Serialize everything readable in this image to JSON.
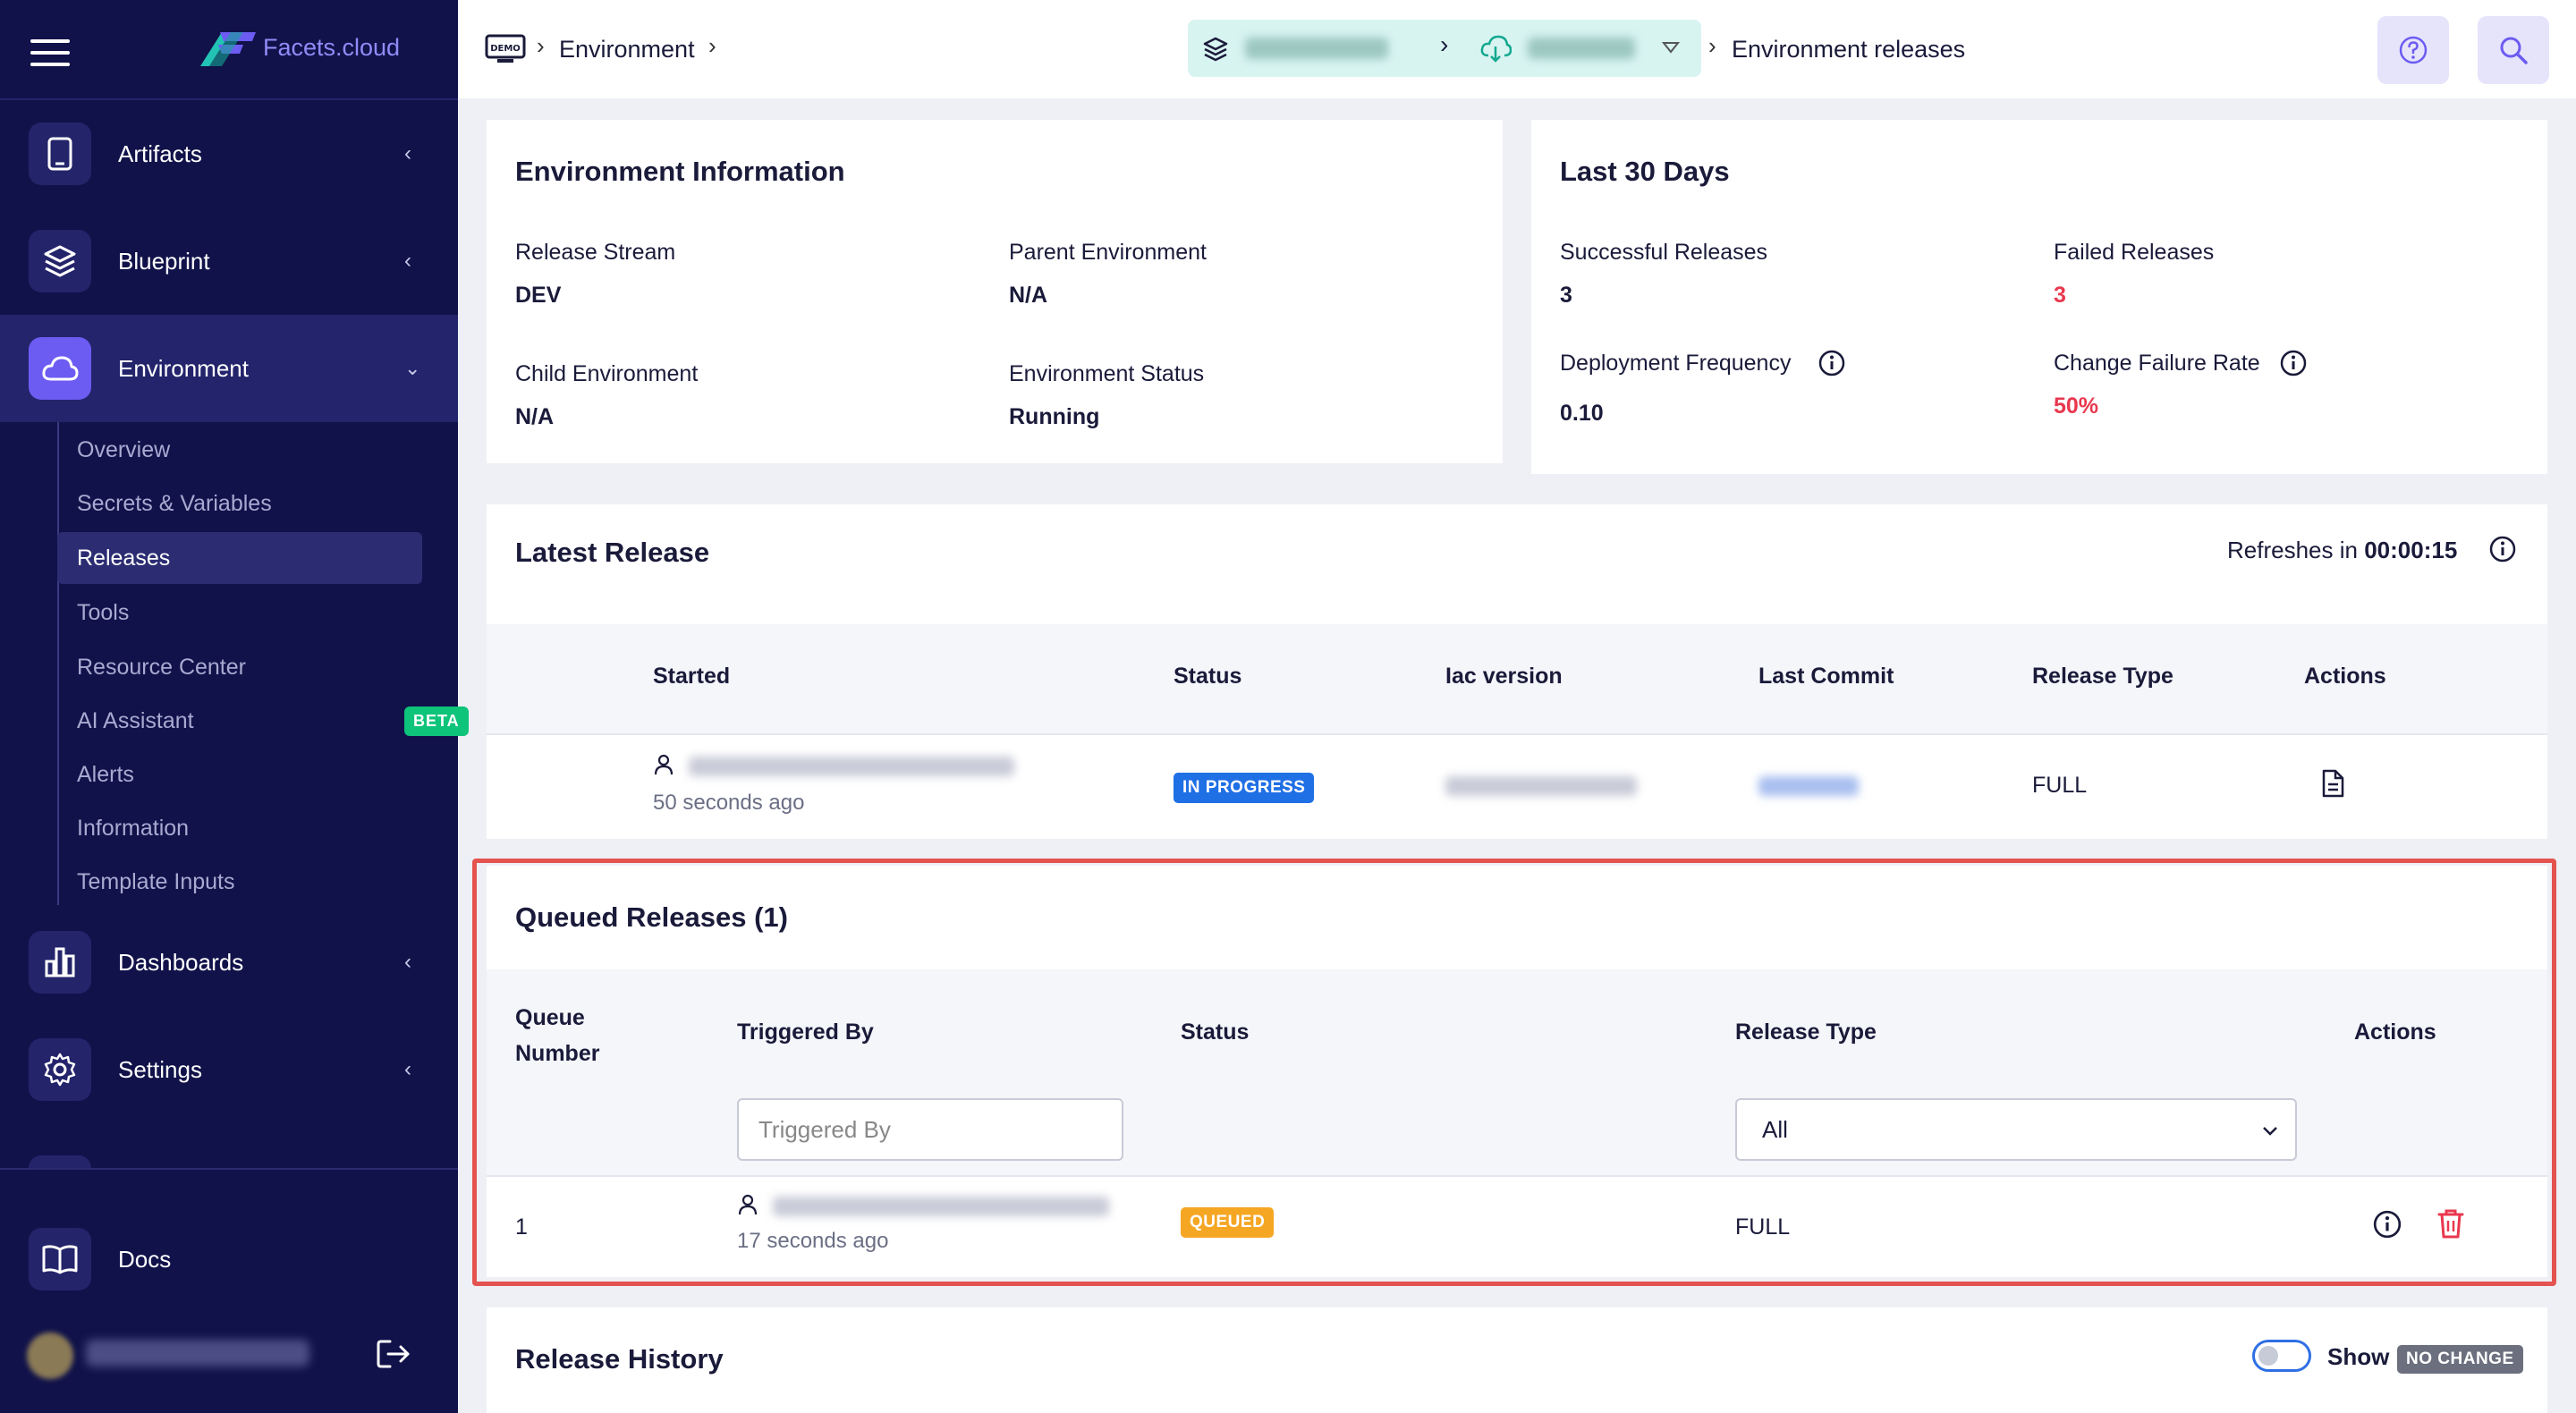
{
  "app": {
    "logo_text": "Facets.cloud"
  },
  "sidebar": {
    "items": [
      {
        "label": "Artifacts",
        "icon": "tablet-icon"
      },
      {
        "label": "Blueprint",
        "icon": "layers-icon"
      },
      {
        "label": "Environment",
        "icon": "cloud-icon"
      },
      {
        "label": "Dashboards",
        "icon": "bar-chart-icon"
      },
      {
        "label": "Settings",
        "icon": "gear-icon"
      }
    ],
    "env_sub": [
      {
        "label": "Overview"
      },
      {
        "label": "Secrets & Variables"
      },
      {
        "label": "Releases"
      },
      {
        "label": "Tools"
      },
      {
        "label": "Resource Center"
      },
      {
        "label": "AI Assistant",
        "badge": "BETA"
      },
      {
        "label": "Alerts"
      },
      {
        "label": "Information"
      },
      {
        "label": "Template Inputs"
      }
    ],
    "docs_label": "Docs"
  },
  "breadcrumb": {
    "demo_label": "DEMO",
    "environment": "Environment",
    "current": "Environment releases"
  },
  "env_info": {
    "title": "Environment Information",
    "release_stream_label": "Release Stream",
    "release_stream_value": "DEV",
    "parent_env_label": "Parent Environment",
    "parent_env_value": "N/A",
    "child_env_label": "Child Environment",
    "child_env_value": "N/A",
    "env_status_label": "Environment Status",
    "env_status_value": "Running"
  },
  "last30": {
    "title": "Last 30 Days",
    "successful_label": "Successful Releases",
    "successful_value": "3",
    "failed_label": "Failed Releases",
    "failed_value": "3",
    "freq_label": "Deployment Frequency",
    "freq_value": "0.10",
    "cfr_label": "Change Failure Rate",
    "cfr_value": "50%"
  },
  "latest": {
    "title": "Latest Release",
    "refresh_prefix": "Refreshes in",
    "refresh_time": "00:00:15",
    "columns": [
      "Started",
      "Status",
      "Iac version",
      "Last Commit",
      "Release Type",
      "Actions"
    ],
    "row": {
      "started_ago": "50 seconds ago",
      "status": "IN PROGRESS",
      "release_type": "FULL"
    }
  },
  "queued": {
    "title": "Queued Releases (1)",
    "col_queue_line1": "Queue",
    "col_queue_line2": "Number",
    "col_triggered": "Triggered By",
    "col_status": "Status",
    "col_release_type": "Release Type",
    "col_actions": "Actions",
    "filter_triggered_placeholder": "Triggered By",
    "filter_release_type_value": "All",
    "row": {
      "queue_number": "1",
      "triggered_ago": "17 seconds ago",
      "status": "QUEUED",
      "release_type": "FULL"
    }
  },
  "history": {
    "title": "Release History",
    "show_label": "Show",
    "no_change_badge": "NO CHANGE"
  },
  "colors": {
    "sidebar_bg": "#11124a",
    "accent": "#6c5cf2",
    "in_progress": "#1f6fe5",
    "queued": "#f5a623",
    "danger": "#e8384f",
    "highlight_border": "#e4534f"
  }
}
